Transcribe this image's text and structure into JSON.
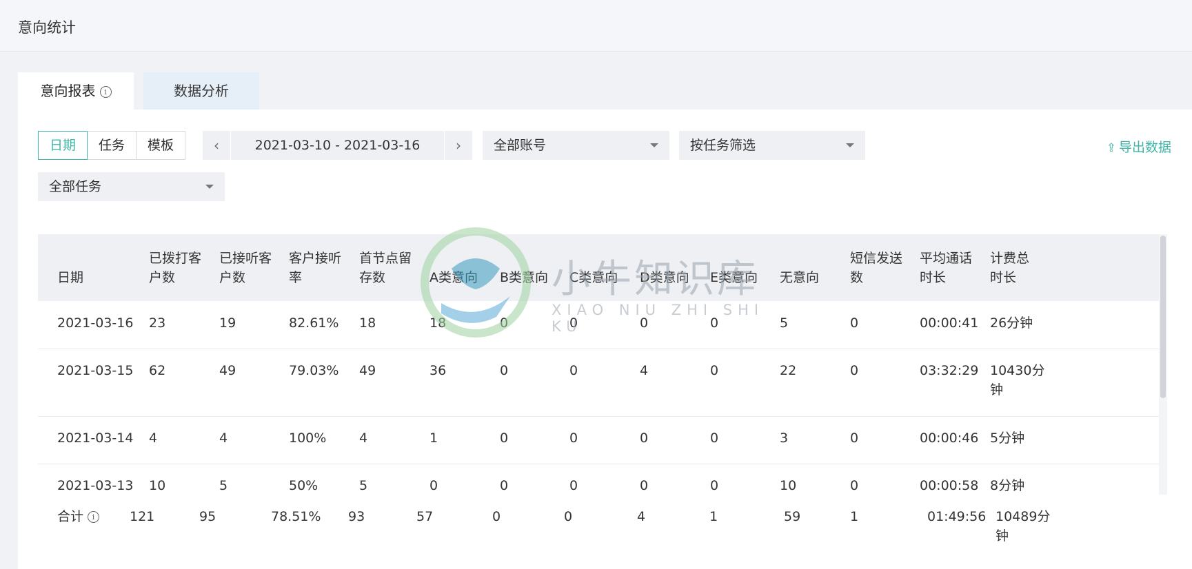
{
  "page": {
    "title": "意向统计"
  },
  "tabs": [
    {
      "label": "意向报表"
    },
    {
      "label": "数据分析"
    }
  ],
  "filters": {
    "segments": [
      "日期",
      "任务",
      "模板"
    ],
    "date_range": "2021-03-10 - 2021-03-16",
    "account": "全部账号",
    "task_filter": "按任务筛选",
    "all_tasks": "全部任务",
    "export": "导出数据"
  },
  "table": {
    "headers": [
      [
        "日期"
      ],
      [
        "已拨打客",
        "户数"
      ],
      [
        "已接听客",
        "户数"
      ],
      [
        "客户接听",
        "率"
      ],
      [
        "首节点留",
        "存数"
      ],
      [
        "A类意向"
      ],
      [
        "B类意向"
      ],
      [
        "C类意向"
      ],
      [
        "D类意向"
      ],
      [
        "E类意向"
      ],
      [
        "无意向"
      ],
      [
        "短信发送",
        "数"
      ],
      [
        "平均通话",
        "时长"
      ],
      [
        "计费总",
        "时长"
      ]
    ],
    "rows": [
      [
        "2021-03-16",
        "23",
        "19",
        "82.61%",
        "18",
        "18",
        "0",
        "0",
        "0",
        "0",
        "5",
        "0",
        "00:00:41",
        "26分钟"
      ],
      [
        "2021-03-15",
        "62",
        "49",
        "79.03%",
        "49",
        "36",
        "0",
        "0",
        "4",
        "0",
        "22",
        "0",
        "03:32:29",
        "10430分钟"
      ],
      [
        "2021-03-14",
        "4",
        "4",
        "100%",
        "4",
        "1",
        "0",
        "0",
        "0",
        "0",
        "3",
        "0",
        "00:00:46",
        "5分钟"
      ],
      [
        "2021-03-13",
        "10",
        "5",
        "50%",
        "5",
        "0",
        "0",
        "0",
        "0",
        "0",
        "10",
        "0",
        "00:00:58",
        "8分钟"
      ]
    ]
  },
  "totals": {
    "label": "合计",
    "values": [
      "121",
      "95",
      "78.51%",
      "93",
      "57",
      "0",
      "0",
      "4",
      "1",
      "59",
      "1",
      "01:49:56",
      "10489分钟"
    ]
  },
  "watermark": {
    "cn": "小牛知识库",
    "en": "XIAO NIU ZHI SHI KU"
  },
  "colors": {
    "accent": "#3fb6a8",
    "header_bg": "#eef0f3"
  }
}
